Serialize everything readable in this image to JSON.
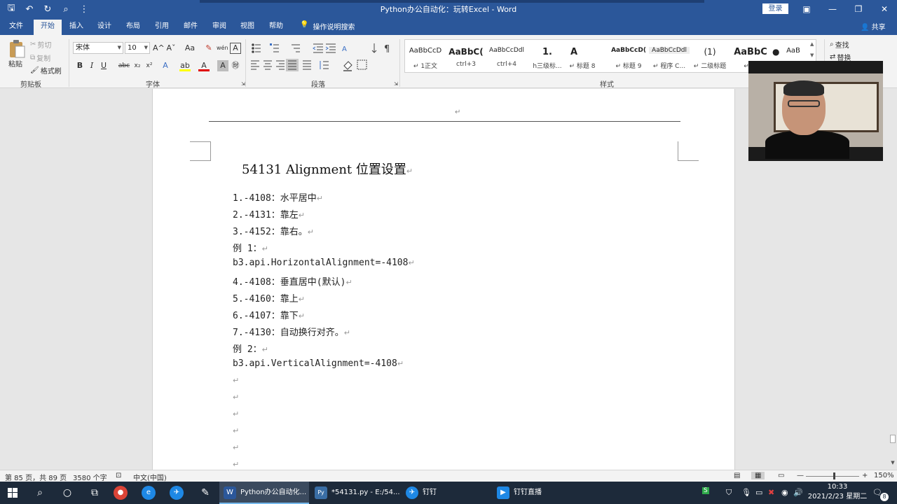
{
  "window": {
    "title": "Python办公自动化：玩转Excel  -  Word",
    "login_label": "登录",
    "controls": {
      "ribbon_display": "▣",
      "minimize": "—",
      "restore": "❐",
      "close": "✕"
    }
  },
  "quick_access": {
    "save": "🖫",
    "undo": "↶",
    "redo": "↻",
    "preview": "⌕",
    "customize": "⋮"
  },
  "tabs": [
    "文件",
    "开始",
    "插入",
    "设计",
    "布局",
    "引用",
    "邮件",
    "审阅",
    "视图",
    "帮助"
  ],
  "tell_me": {
    "icon": "💡",
    "label": "操作说明搜索"
  },
  "share_label": "共享",
  "ribbon": {
    "clipboard": {
      "paste_label": "粘贴",
      "cut_label": "剪切",
      "copy_label": "复制",
      "format_painter_label": "格式刷",
      "group_label": "剪贴板"
    },
    "font": {
      "font_name": "宋体",
      "font_size": "10",
      "bold": "B",
      "italic": "I",
      "underline": "U",
      "strike": "abc",
      "subscript": "x₂",
      "superscript": "x²",
      "grow": "A^",
      "shrink": "Aˇ",
      "case": "Aa",
      "clear": "✎",
      "wen": "wén",
      "border_a": "A",
      "effects": "A",
      "highlight": "ab",
      "color": "A",
      "shade": "A",
      "circle": "㊖",
      "group_label": "字体"
    },
    "paragraph": {
      "group_label": "段落"
    },
    "styles": {
      "items": [
        {
          "preview": "AaBbCcD",
          "label": "↵ 1正文"
        },
        {
          "preview": "AaBbC(",
          "label": "ctrl+3"
        },
        {
          "preview": "AaBbCcDdl",
          "label": "ctrl+4"
        },
        {
          "preview": "1.",
          "label": "h三级标..."
        },
        {
          "preview": "A",
          "label": "↵ 标题 8"
        },
        {
          "preview": "AaBbCcD(",
          "label": "↵ 标题 9"
        },
        {
          "preview": "AaBbCcDdl",
          "label": "↵ 程序  C..."
        },
        {
          "preview": "(1)",
          "label": "↵ 二级标题"
        },
        {
          "preview": "AaBbC",
          "label": "↵ 例"
        },
        {
          "preview": "AaB",
          "label": ""
        }
      ],
      "group_label": "样式"
    },
    "editing": {
      "find_label": "查找",
      "replace_label": "替换"
    }
  },
  "document": {
    "header_mark": "↵",
    "heading": "54131  Alignment 位置设置",
    "paragraphs": [
      "1.-4108：水平居中",
      "2.-4131：靠左",
      "3.-4152：靠右。",
      "例 1：",
      "b3.api.HorizontalAlignment=-4108",
      "4.-4108：垂直居中(默认)",
      "5.-4160：靠上",
      "6.-4107：靠下",
      "7.-4130：自动换行对齐。",
      "例 2：",
      "b3.api.VerticalAlignment=-4108",
      "",
      "",
      "",
      "",
      "",
      ""
    ],
    "paragraph_mark": "↵"
  },
  "statusbar": {
    "page_info": "第 85 页，共 89 页",
    "word_count": "3580 个字",
    "language": "中文(中国)",
    "zoom_minus": "—",
    "zoom_plus": "+",
    "zoom_level": "150%"
  },
  "taskbar": {
    "apps": [
      {
        "label": "Python办公自动化...",
        "icon": "W",
        "color": "#2b579a"
      },
      {
        "label": "*54131.py - E:/54...",
        "icon": "Py",
        "color": "#3a6ea5"
      },
      {
        "label": "钉钉",
        "icon": "✈",
        "color": "#1e88e5"
      },
      {
        "label": "钉钉直播",
        "icon": "▶",
        "color": "#1e88e5"
      }
    ],
    "clock_time": "10:33",
    "clock_date": "2021/2/23 星期二",
    "notification_count": "8"
  },
  "colors": {
    "accent": "#2b579a",
    "taskbar": "#1d2a3a"
  }
}
